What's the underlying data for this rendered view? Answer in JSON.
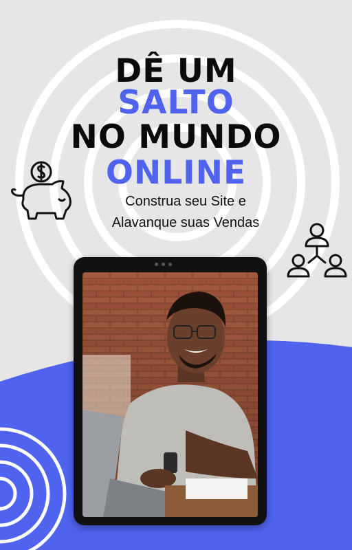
{
  "headline": {
    "line1": "DÊ UM",
    "line2": "SALTO",
    "line3": "NO MUNDO",
    "line4": "ONLINE"
  },
  "subtitle": {
    "line1": "Construa seu Site e",
    "line2": "Alavanque suas Vendas"
  },
  "icons": {
    "piggy": "piggy-bank-icon",
    "network": "people-network-icon"
  },
  "colors": {
    "accent": "#4f63ee",
    "text": "#0b0b0b",
    "background": "#e6e6e6"
  }
}
